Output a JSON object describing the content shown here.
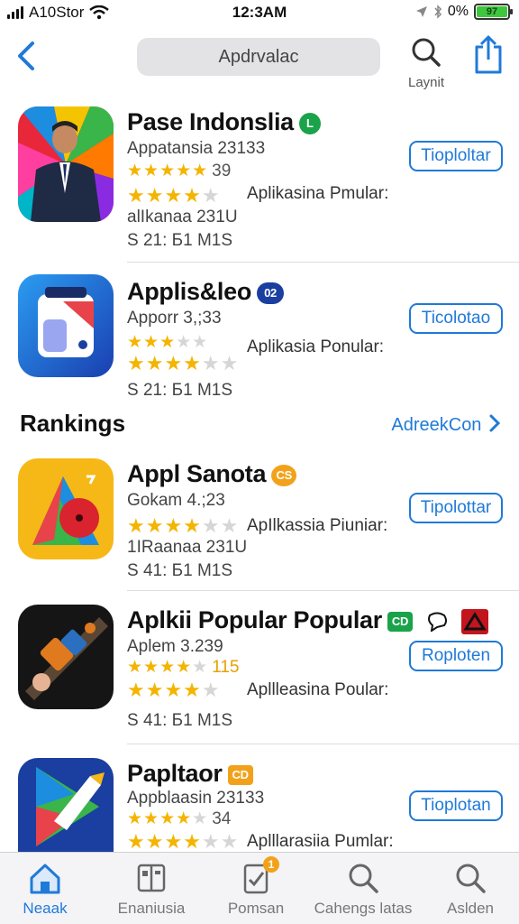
{
  "status_bar": {
    "carrier": "A10Stor",
    "time": "12:3AM",
    "battery_text": "0%",
    "battery_badge": "97"
  },
  "nav": {
    "search_text": "Apdrvalac",
    "search_label": "Laynit"
  },
  "apps": [
    {
      "name": "Pase Indonslia",
      "badge_text": "L",
      "badge_color": "#1aa34a",
      "line1": "Appatansia 23133",
      "stars1": 5,
      "count1": "39",
      "stars2": 4,
      "popular": "Aplikasina Pmular:",
      "line2": "alIkanaa 231U",
      "size": "S 21:  Б1 M1S",
      "button": "Tioploltar"
    },
    {
      "name": "Applis&leo",
      "badge_text": "02",
      "badge_color": "#1b3fa0",
      "line1": "Apporr 3,;33",
      "stars1": 3,
      "stars2": 4,
      "popular": "Aplikasia Ponular:",
      "size": "S 21:  Б1 M1S",
      "button": "Ticolotao"
    },
    {
      "name": "Appl Sanota",
      "badge_text": "CS",
      "badge_color": "#f2a21a",
      "line1": "Gokam 4.;23",
      "stars1": 4,
      "popular": "ApIlkassia Piuniar:",
      "line2": "1IRaanaa 231U",
      "size": "S 41:  Б1 M1S",
      "button": "Tipolottar"
    },
    {
      "name": "Aplkii Popular Popular",
      "badge_text": "CD",
      "badge_color": "#1aa34a",
      "line1": "Aplem 3.239",
      "stars1": 4,
      "count1": "115",
      "stars2": 4,
      "popular": "Apllleasina Poular:",
      "size": "S 41:  Б1 M1S",
      "button": "Roploten"
    },
    {
      "name": "Papltaor",
      "badge_text": "CD",
      "badge_color": "#f2a21a",
      "line1": "Appblaasin 23133",
      "stars1": 4,
      "count1": "34",
      "stars2": 4,
      "popular": "Aplllarasiia Pumlar:",
      "button": "Tioplotan"
    }
  ],
  "section": {
    "title": "Rankings",
    "see_all": "AdreekCon"
  },
  "tabs": [
    {
      "label": "Neaak",
      "icon": "home-icon",
      "active": true
    },
    {
      "label": "Enaniusia",
      "icon": "apps-grid-icon"
    },
    {
      "label": "Pomsan",
      "icon": "clipboard-icon",
      "badge": "1"
    },
    {
      "label": "Cahengs latas",
      "icon": "search-icon"
    },
    {
      "label": "Aslden",
      "icon": "search-icon"
    }
  ],
  "colors": {
    "accent": "#1f7ad8",
    "star": "#f4b400"
  }
}
